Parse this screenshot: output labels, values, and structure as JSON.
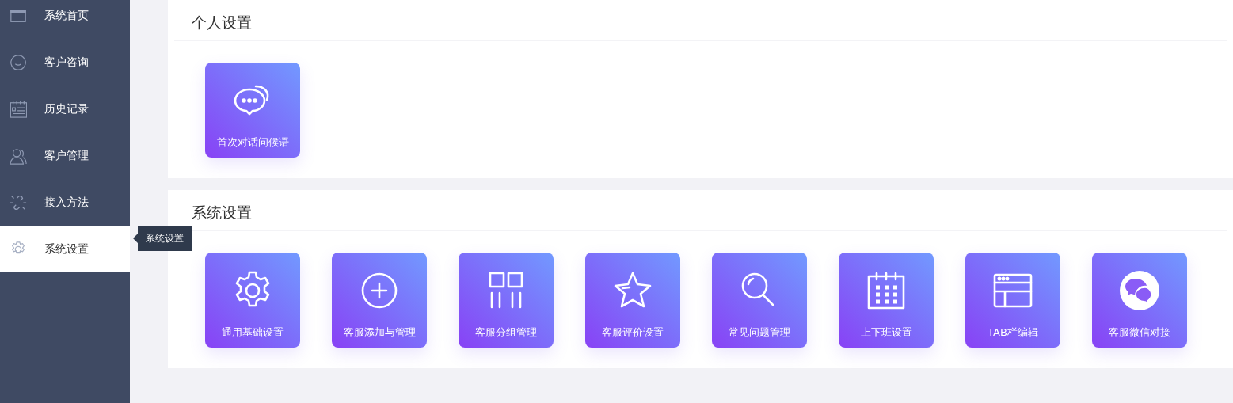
{
  "sidebar": {
    "items": [
      {
        "label": "系统首页",
        "kind": "window",
        "selected": false
      },
      {
        "label": "客户咨询",
        "kind": "smile",
        "selected": false
      },
      {
        "label": "历史记录",
        "kind": "record",
        "selected": false
      },
      {
        "label": "客户管理",
        "kind": "users",
        "selected": false
      },
      {
        "label": "接入方法",
        "kind": "link",
        "selected": false
      },
      {
        "label": "系统设置",
        "kind": "gear",
        "selected": true
      }
    ],
    "tooltip": "系统设置"
  },
  "sections": [
    {
      "title": "个人设置",
      "tiles": [
        {
          "label": "首次对话问候语",
          "kind": "chat"
        }
      ]
    },
    {
      "title": "系统设置",
      "tiles": [
        {
          "label": "通用基础设置",
          "kind": "gear"
        },
        {
          "label": "客服添加与管理",
          "kind": "plus"
        },
        {
          "label": "客服分组管理",
          "kind": "grid"
        },
        {
          "label": "客服评价设置",
          "kind": "star"
        },
        {
          "label": "常见问题管理",
          "kind": "search"
        },
        {
          "label": "上下班设置",
          "kind": "calendar"
        },
        {
          "label": "TAB栏编辑",
          "kind": "browser"
        },
        {
          "label": "客服微信对接",
          "kind": "wechat"
        }
      ]
    }
  ]
}
